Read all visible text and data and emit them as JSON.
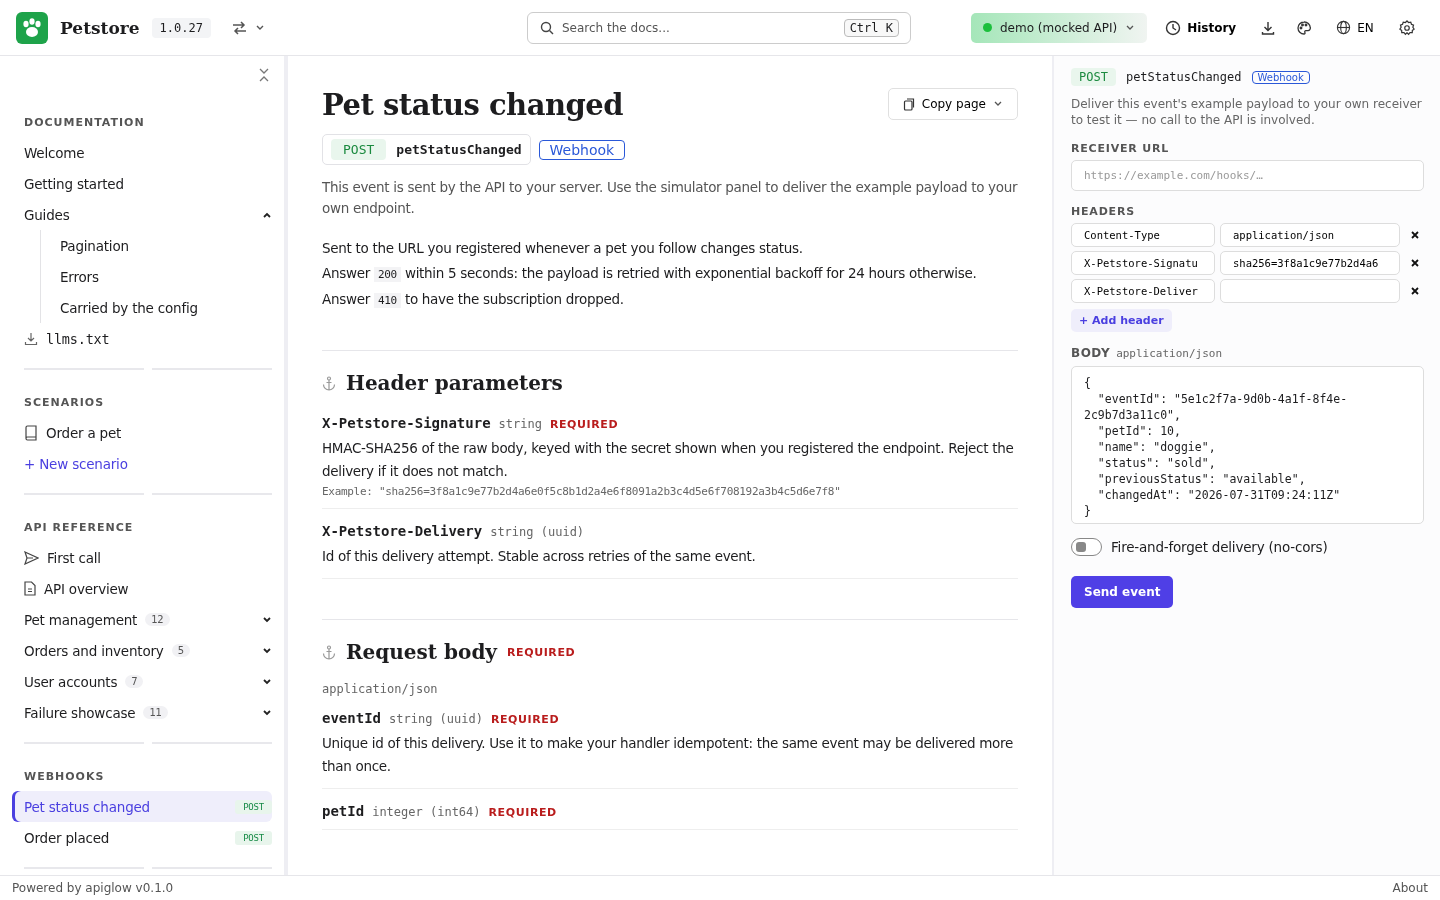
{
  "header": {
    "title": "Petstore",
    "version": "1.0.27",
    "search_placeholder": "Search the docs...",
    "shortcut": "Ctrl K",
    "environment": "demo (mocked API)",
    "history": "History",
    "language": "EN"
  },
  "sidebar": {
    "sections": [
      {
        "title": "DOCUMENTATION",
        "items": [
          {
            "label": "Welcome",
            "kind": "plain",
            "selected": false
          },
          {
            "label": "Getting started",
            "kind": "plain",
            "selected": false
          },
          {
            "label": "Guides",
            "kind": "group",
            "expanded": true,
            "selected": false,
            "children": [
              {
                "label": "Pagination",
                "selected": false
              },
              {
                "label": "Errors",
                "selected": false
              },
              {
                "label": "Carried by the config",
                "selected": false
              }
            ]
          },
          {
            "label": "llms.txt",
            "kind": "download",
            "selected": false
          }
        ]
      },
      {
        "title": "SCENARIOS",
        "items": [
          {
            "label": "Order a pet",
            "kind": "scenario",
            "selected": false
          },
          {
            "label": "+ New scenario",
            "kind": "add",
            "selected": false
          }
        ]
      },
      {
        "title": "API REFERENCE",
        "items": [
          {
            "label": "First call",
            "kind": "call",
            "selected": false
          },
          {
            "label": "API overview",
            "kind": "doc",
            "selected": false
          },
          {
            "label": "Pet management",
            "kind": "group",
            "count": "12",
            "expanded": false,
            "selected": false
          },
          {
            "label": "Orders and inventory",
            "kind": "group",
            "count": "5",
            "expanded": false,
            "selected": false
          },
          {
            "label": "User accounts",
            "kind": "group",
            "count": "7",
            "expanded": false,
            "selected": false
          },
          {
            "label": "Failure showcase",
            "kind": "group",
            "count": "11",
            "expanded": false,
            "selected": false
          }
        ]
      },
      {
        "title": "WEBHOOKS",
        "items": [
          {
            "label": "Pet status changed",
            "kind": "webhook",
            "method": "POST",
            "selected": true
          },
          {
            "label": "Order placed",
            "kind": "webhook",
            "method": "POST",
            "selected": false
          }
        ]
      }
    ]
  },
  "page": {
    "title": "Pet status changed",
    "method": "POST",
    "operation": "petStatusChanged",
    "tag": "Webhook",
    "copy_button": "Copy page",
    "intro": "This event is sent by the API to your server. Use the simulator panel to deliver the example payload to your own endpoint.",
    "paragraphs": [
      [
        {
          "kind": "text",
          "text": "Sent to the URL you registered whenever a pet you follow changes status."
        }
      ],
      [
        {
          "kind": "text",
          "text": "Answer"
        },
        {
          "kind": "code",
          "text": "200"
        },
        {
          "kind": "text",
          "text": "within 5 seconds: the payload is retried with exponential backoff for 24 hours otherwise."
        }
      ],
      [
        {
          "kind": "text",
          "text": "Answer"
        },
        {
          "kind": "code",
          "text": "410"
        },
        {
          "kind": "text",
          "text": "to have the subscription dropped."
        }
      ]
    ],
    "sections": [
      {
        "title": "Header parameters",
        "params": [
          {
            "name": "X-Petstore-Signature",
            "type": "string",
            "required": "REQUIRED",
            "description": "HMAC-SHA256 of the raw body, keyed with the secret shown when you registered the endpoint. Reject the delivery if it does not match.",
            "example": "Example: \"sha256=3f8a1c9e77b2d4a6e0f5c8b1d2a4e6f8091a2b3c4d5e6f708192a3b4c5d6e7f8\""
          },
          {
            "name": "X-Petstore-Delivery",
            "type": "string (uuid)",
            "description": "Id of this delivery attempt. Stable across retries of the same event."
          }
        ]
      },
      {
        "title": "Request body",
        "required": "REQUIRED",
        "content_type": "application/json",
        "params": [
          {
            "name": "eventId",
            "type": "string (uuid)",
            "required": "REQUIRED",
            "description": "Unique id of this delivery. Use it to make your handler idempotent: the same event may be delivered more than once."
          },
          {
            "name": "petId",
            "type": "integer (int64)",
            "required": "REQUIRED"
          }
        ]
      }
    ]
  },
  "simulator": {
    "method": "POST",
    "operation": "petStatusChanged",
    "tag": "Webhook",
    "description": "Deliver this event's example payload to your own receiver to test it — no call to the API is involved.",
    "receiver_label": "RECEIVER URL",
    "receiver_placeholder": "https://example.com/hooks/…",
    "headers_label": "HEADERS",
    "headers": [
      {
        "name": "Content-Type",
        "value": "application/json"
      },
      {
        "name": "X-Petstore-Signatu",
        "value": "sha256=3f8a1c9e77b2d4a6"
      },
      {
        "name": "X-Petstore-Deliver"
      }
    ],
    "add_header": "+ Add header",
    "body_label": "BODY",
    "body_type": "application/json",
    "body": "{\n  \"eventId\": \"5e1c2f7a-9d0b-4a1f-8f4e-2c9b7d3a11c0\",\n  \"petId\": 10,\n  \"name\": \"doggie\",\n  \"status\": \"sold\",\n  \"previousStatus\": \"available\",\n  \"changedAt\": \"2026-07-31T09:24:11Z\"\n}",
    "toggle": {
      "label": "Fire-and-forget delivery (no-cors)",
      "on": false
    },
    "send_button": "Send event"
  },
  "footer": {
    "powered": "Powered by apiglow v0.1.0",
    "about": "About"
  }
}
